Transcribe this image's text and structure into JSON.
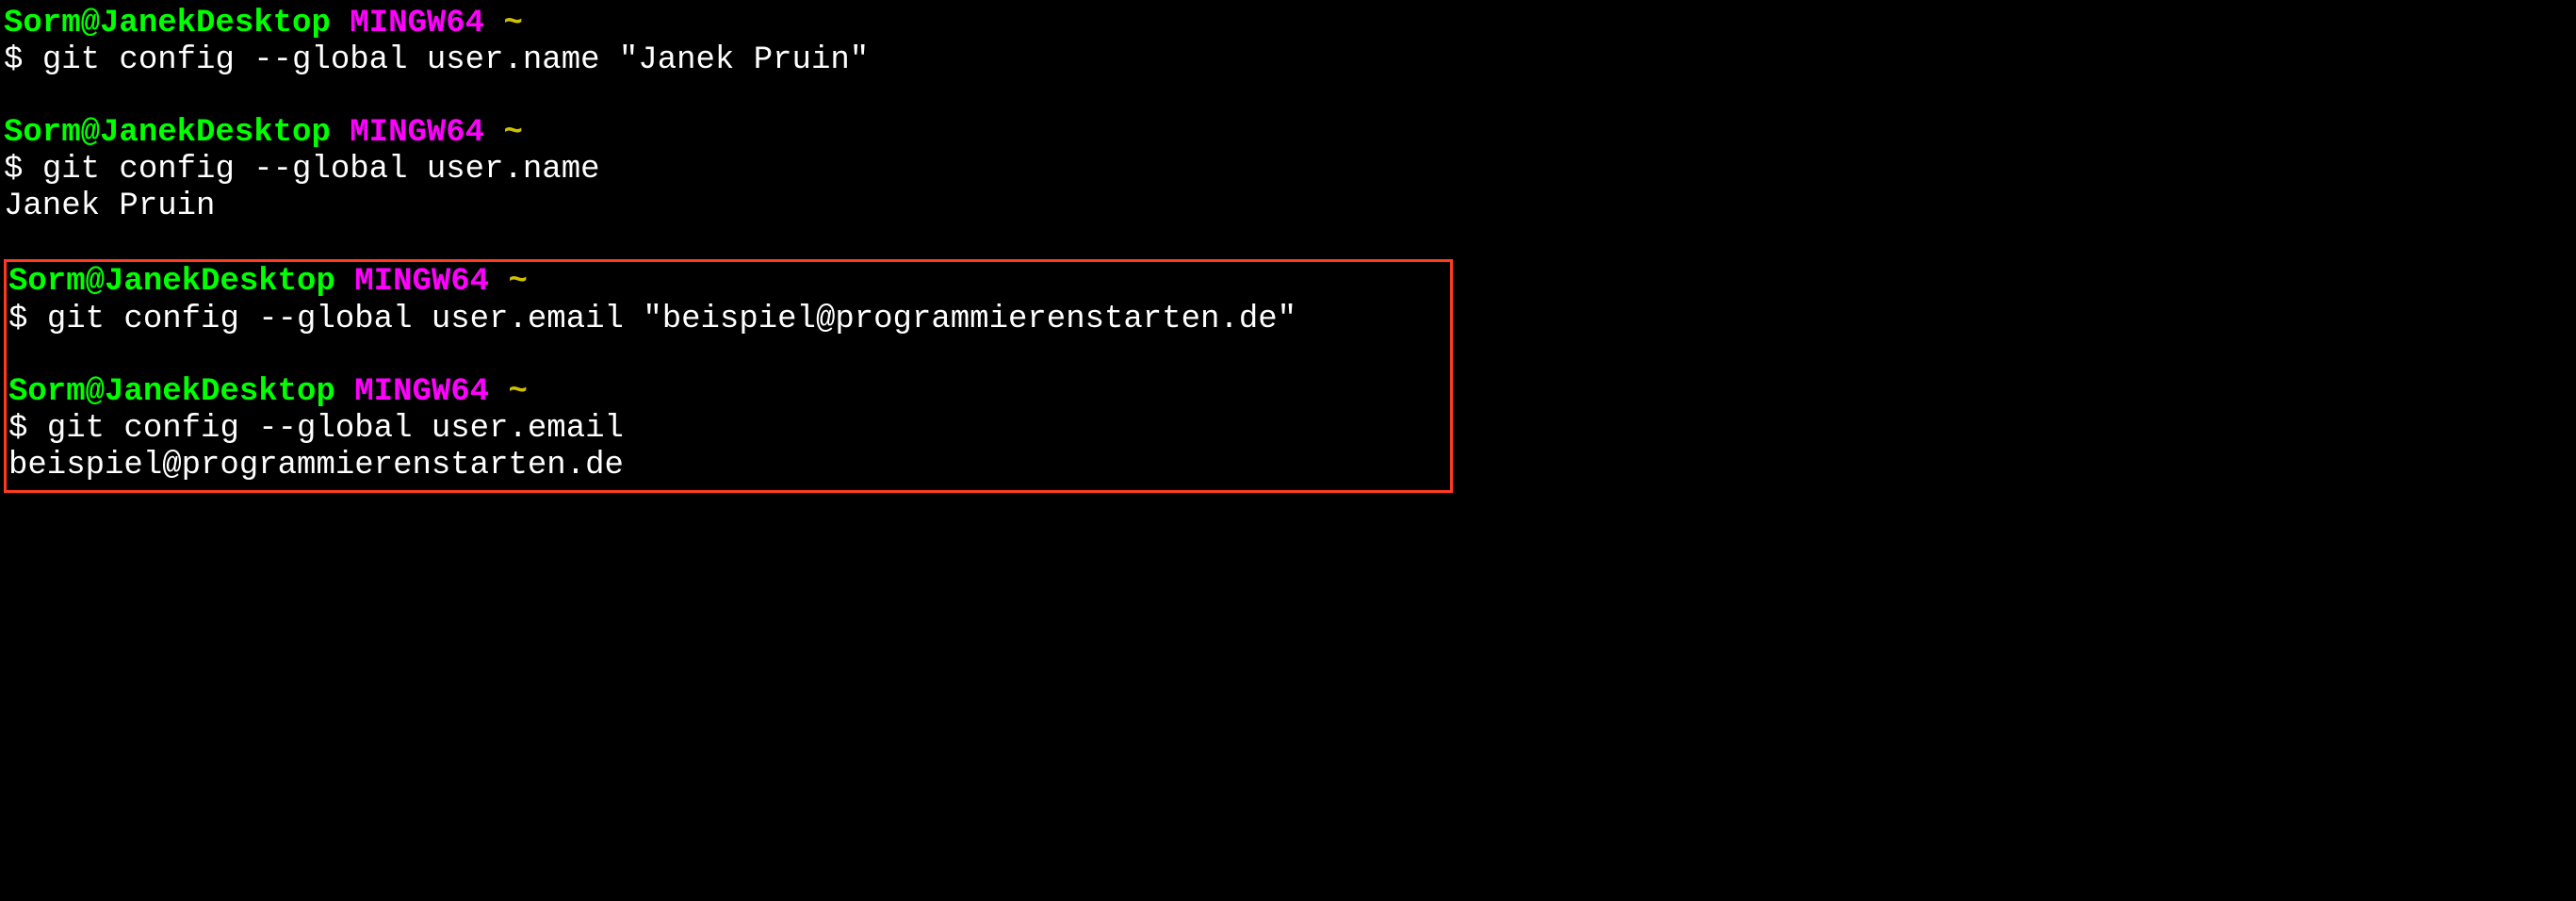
{
  "prompt": {
    "user_host": "Sorm@JanekDesktop",
    "env": "MINGW64",
    "path": "~",
    "symbol": "$"
  },
  "blocks": [
    {
      "command": "git config --global user.name \"Janek Pruin\"",
      "output": null
    },
    {
      "command": "git config --global user.name",
      "output": "Janek Pruin"
    }
  ],
  "highlighted_blocks": [
    {
      "command": "git config --global user.email \"beispiel@programmierenstarten.de\"",
      "output": null
    },
    {
      "command": "git config --global user.email",
      "output": "beispiel@programmierenstarten.de"
    }
  ]
}
